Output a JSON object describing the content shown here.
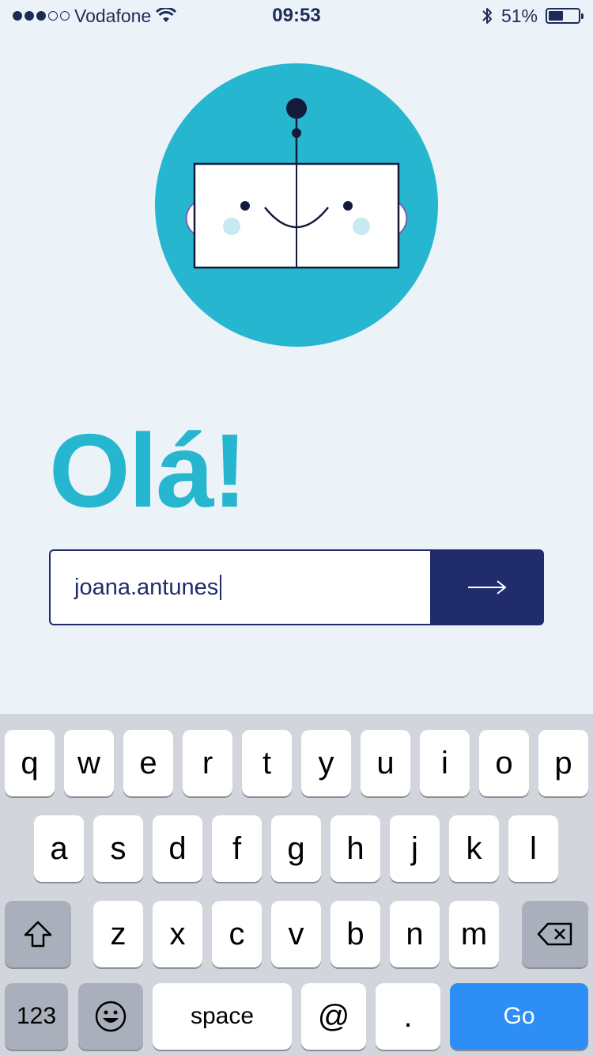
{
  "status_bar": {
    "carrier": "Vodafone",
    "time": "09:53",
    "battery_percent": "51%",
    "battery_level": 0.51,
    "signal_bars_filled": 3,
    "signal_bars_total": 5
  },
  "greeting": "Olá!",
  "login": {
    "username_value": "joana.antunes",
    "submit_icon": "arrow-right-icon"
  },
  "keyboard": {
    "row1": [
      "q",
      "w",
      "e",
      "r",
      "t",
      "y",
      "u",
      "i",
      "o",
      "p"
    ],
    "row2": [
      "a",
      "s",
      "d",
      "f",
      "g",
      "h",
      "j",
      "k",
      "l"
    ],
    "row3": [
      "z",
      "x",
      "c",
      "v",
      "b",
      "n",
      "m"
    ],
    "numbers_label": "123",
    "space_label": "space",
    "at_label": "@",
    "period_label": ".",
    "go_label": "Go"
  },
  "colors": {
    "background": "#ecf3f8",
    "accent_teal": "#27b6cf",
    "navy": "#202c6c",
    "go_blue": "#2d8ff5"
  }
}
